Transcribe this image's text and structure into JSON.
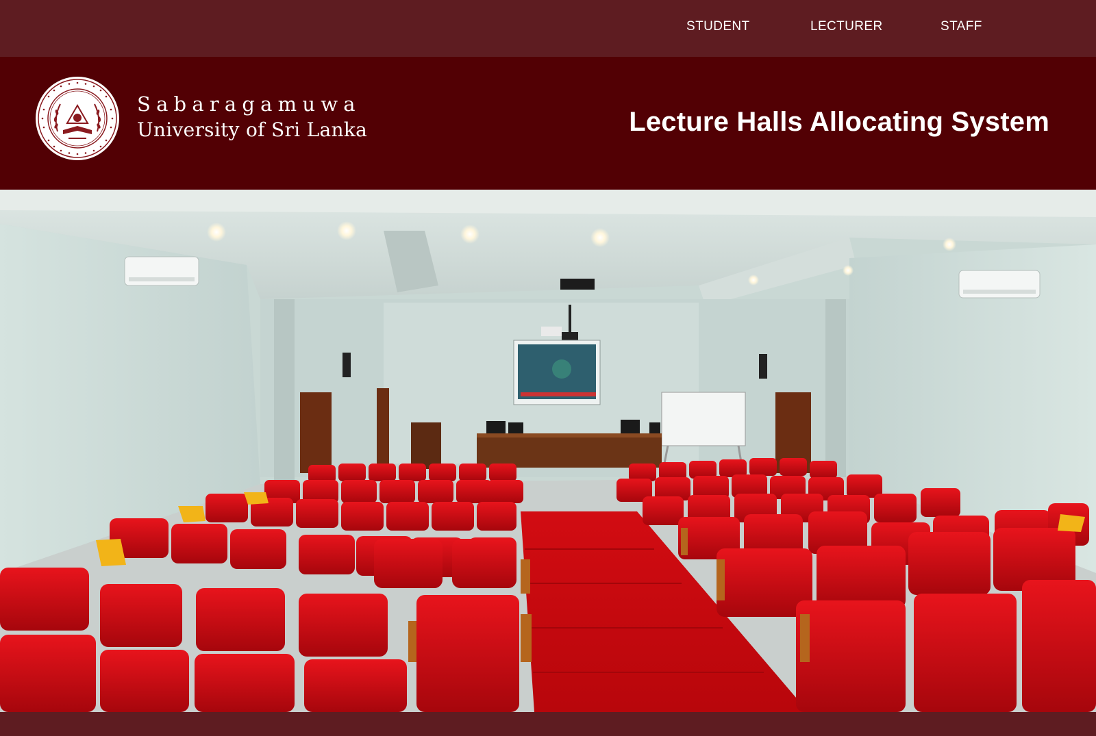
{
  "nav": {
    "items": [
      {
        "label": "STUDENT"
      },
      {
        "label": "LECTURER"
      },
      {
        "label": "STAFF"
      }
    ]
  },
  "header": {
    "university_line1": "Sabaragamuwa",
    "university_line2": "University of Sri Lanka",
    "title": "Lecture Halls Allocating System",
    "logo_icon": "university-crest-icon"
  },
  "hero": {
    "image": "lecture-hall-photo"
  },
  "colors": {
    "nav_bg": "#5e1c21",
    "header_bg": "#520004",
    "text": "#ffffff",
    "seat_red": "#d2141c",
    "carpet_red": "#c80a10"
  }
}
